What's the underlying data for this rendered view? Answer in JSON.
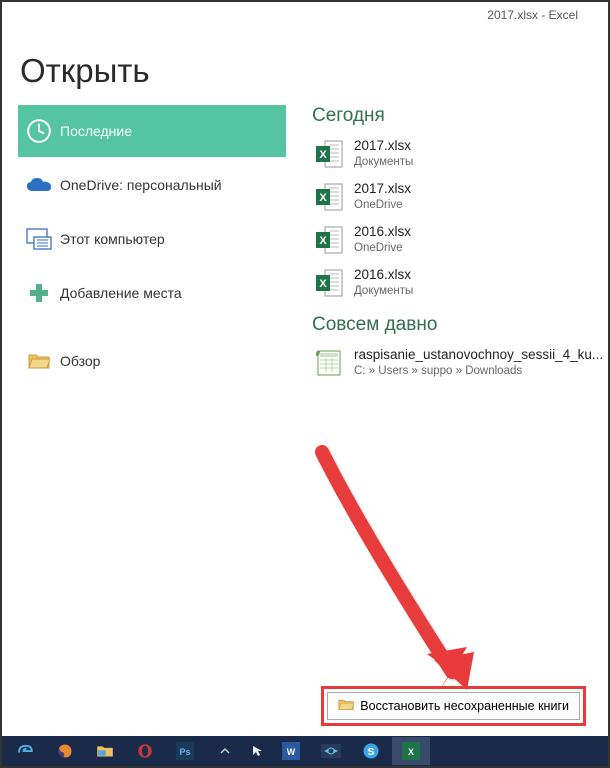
{
  "window_title": "2017.xlsx - Excel",
  "page_title": "Открыть",
  "nav": {
    "recent": "Последние",
    "onedrive": "OneDrive: персональный",
    "this_pc": "Этот компьютер",
    "add_place": "Добавление места",
    "browse": "Обзор"
  },
  "sections": {
    "today": "Сегодня",
    "longtime": "Совсем давно"
  },
  "files_today": [
    {
      "name": "2017.xlsx",
      "loc": "Документы"
    },
    {
      "name": "2017.xlsx",
      "loc": "OneDrive"
    },
    {
      "name": "2016.xlsx",
      "loc": "OneDrive"
    },
    {
      "name": "2016.xlsx",
      "loc": "Документы"
    }
  ],
  "files_longtime": [
    {
      "name": "raspisanie_ustanovochnoy_sessii_4_ku...",
      "loc": "C: » Users » suppo » Downloads"
    }
  ],
  "recover_label": "Восстановить несохраненные книги",
  "colors": {
    "accent": "#54c5a0",
    "section_title": "#326e51",
    "annotation": "#e83a3a"
  }
}
